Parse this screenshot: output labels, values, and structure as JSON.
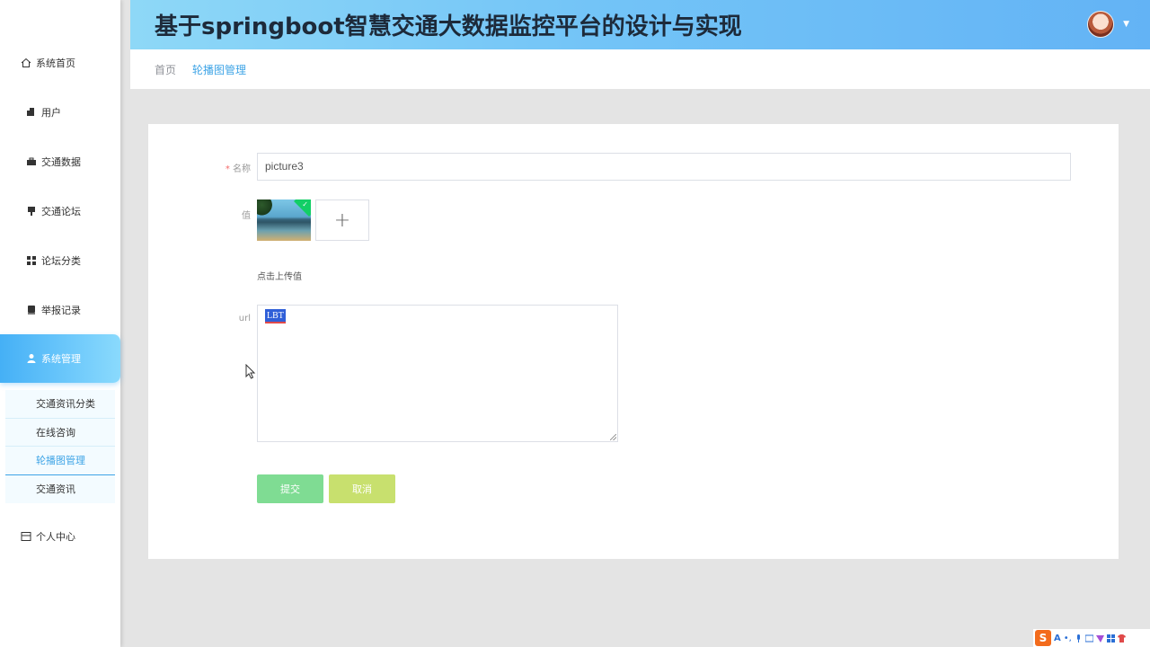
{
  "header": {
    "title": "基于springboot智慧交通大数据监控平台的设计与实现"
  },
  "breadcrumb": {
    "home": "首页",
    "current": "轮播图管理"
  },
  "sidebar": {
    "items": [
      {
        "label": "系统首页",
        "icon": "home-icon"
      },
      {
        "label": "用户",
        "icon": "user-icon"
      },
      {
        "label": "交通数据",
        "icon": "briefcase-icon"
      },
      {
        "label": "交通论坛",
        "icon": "pin-icon"
      },
      {
        "label": "论坛分类",
        "icon": "grid-icon"
      },
      {
        "label": "举报记录",
        "icon": "record-icon"
      },
      {
        "label": "系统管理",
        "icon": "person-icon",
        "active": true
      },
      {
        "label": "个人中心",
        "icon": "panel-icon"
      }
    ],
    "submenu": [
      {
        "label": "交通资讯分类"
      },
      {
        "label": "在线咨询"
      },
      {
        "label": "轮播图管理",
        "current": true
      },
      {
        "label": "交通资讯"
      }
    ]
  },
  "form": {
    "name_required_mark": "*",
    "name_label": "名称",
    "name_value": "picture3",
    "value_label": "值",
    "upload_hint": "点击上传值",
    "upload_plus": "+",
    "url_label": "url",
    "url_value": "LBT",
    "submit_label": "提交",
    "cancel_label": "取消"
  },
  "ime": {
    "logo": "S",
    "lang": "A"
  },
  "colors": {
    "accent": "#3ea4e6",
    "submit": "#7fdc93",
    "cancel": "#c8e06e",
    "required": "#f56c6c"
  }
}
